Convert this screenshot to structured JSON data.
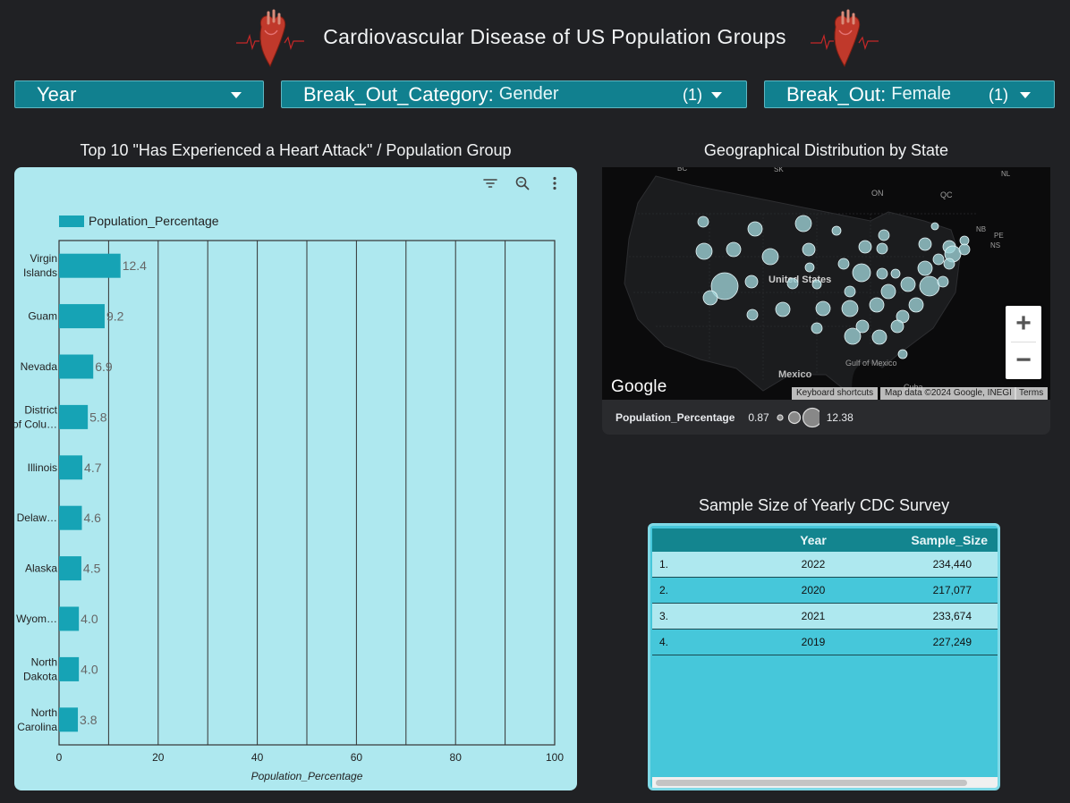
{
  "header": {
    "title": "Cardiovascular Disease of US Population Groups",
    "left_icon": "heart-icon",
    "right_icon": "heart-icon"
  },
  "controls": {
    "year": {
      "label": "Year"
    },
    "category": {
      "label": "Break_Out_Category:",
      "value": "Gender",
      "count": "(1)"
    },
    "breakout": {
      "label": "Break_Out:",
      "value": "Female",
      "count": "(1)"
    }
  },
  "bar_section": {
    "title": "Top 10 \"Has Experienced a Heart Attack\" / Population Group",
    "tools": [
      "filter-icon",
      "zoom-icon",
      "more-vert-icon"
    ]
  },
  "chart_data": {
    "type": "bar",
    "orientation": "horizontal",
    "categories": [
      "Virgin Islands",
      "Guam",
      "Nevada",
      "District of Colu…",
      "Illinois",
      "Delaw…",
      "Alaska",
      "Wyom…",
      "North Dakota",
      "North Carolina"
    ],
    "series": [
      {
        "name": "Population_Percentage",
        "values": [
          12.4,
          9.2,
          6.9,
          5.8,
          4.7,
          4.6,
          4.5,
          4.0,
          4.0,
          3.8
        ]
      }
    ],
    "value_labels": [
      "12.4",
      "9.2",
      "6.9",
      "5.8",
      "4.7",
      "4.6",
      "4.5",
      "4.0",
      "4.0",
      "3.8"
    ],
    "xlim": [
      0,
      100
    ],
    "xticks": [
      0,
      20,
      40,
      60,
      80,
      100
    ],
    "xlabel": "Population_Percentage",
    "legend": "top-left",
    "grid": true,
    "color": "#16a3b5"
  },
  "map_section": {
    "title": "Geographical Distribution by State",
    "labels": {
      "country": "United States",
      "mexico": "Mexico",
      "gulf": "Gulf of Mexico",
      "cuba": "Cuba",
      "on": "ON",
      "qc": "QC",
      "nb": "NB",
      "pe": "PE",
      "ns": "NS",
      "nl": "NL",
      "bc": "BC",
      "sk": "SK"
    },
    "google": "Google",
    "attribution": {
      "shortcuts": "Keyboard shortcuts",
      "data": "Map data ©2024 Google, INEGI",
      "terms": "Terms"
    },
    "legend": {
      "label": "Population_Percentage",
      "min": "0.87",
      "max": "12.38"
    }
  },
  "table_section": {
    "title": "Sample Size of Yearly CDC Survey",
    "headers": {
      "year": "Year",
      "size": "Sample_Size"
    },
    "rows": [
      {
        "idx": "1.",
        "year": "2022",
        "size": "234,440"
      },
      {
        "idx": "2.",
        "year": "2020",
        "size": "217,077"
      },
      {
        "idx": "3.",
        "year": "2021",
        "size": "233,674"
      },
      {
        "idx": "4.",
        "year": "2019",
        "size": "227,249"
      }
    ]
  }
}
